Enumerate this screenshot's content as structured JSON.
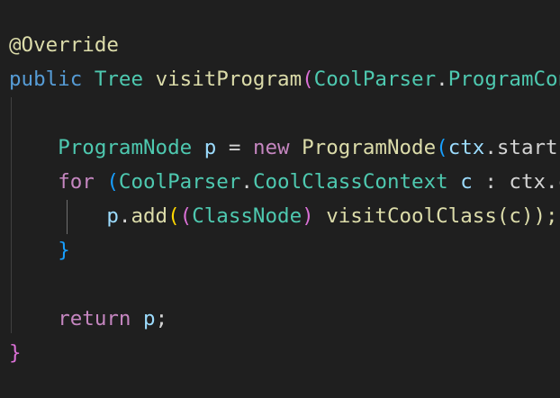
{
  "editor": {
    "language": "java",
    "theme": "dark-plus",
    "lines": [
      {
        "tokens": [
          {
            "text": "@Override",
            "kind": "annotation"
          }
        ]
      },
      {
        "tokens": [
          {
            "text": "public",
            "kind": "keyword"
          },
          {
            "text": " ",
            "kind": "plain"
          },
          {
            "text": "Tree",
            "kind": "type"
          },
          {
            "text": " ",
            "kind": "plain"
          },
          {
            "text": "visitProgram",
            "kind": "method"
          },
          {
            "text": "(",
            "kind": "paren1"
          },
          {
            "text": "CoolParser",
            "kind": "type"
          },
          {
            "text": ".",
            "kind": "plain"
          },
          {
            "text": "ProgramContext ctx",
            "kind": "type"
          }
        ]
      },
      {
        "tokens": []
      },
      {
        "tokens": [
          {
            "text": "    ",
            "kind": "plain"
          },
          {
            "text": "ProgramNode",
            "kind": "type"
          },
          {
            "text": " ",
            "kind": "plain"
          },
          {
            "text": "p",
            "kind": "var"
          },
          {
            "text": " = ",
            "kind": "op"
          },
          {
            "text": "new",
            "kind": "control"
          },
          {
            "text": " ",
            "kind": "plain"
          },
          {
            "text": "ProgramNode",
            "kind": "method"
          },
          {
            "text": "(",
            "kind": "paren2"
          },
          {
            "text": "ctx",
            "kind": "var"
          },
          {
            "text": ".start);",
            "kind": "plain"
          }
        ]
      },
      {
        "tokens": [
          {
            "text": "    ",
            "kind": "plain"
          },
          {
            "text": "for",
            "kind": "control"
          },
          {
            "text": " ",
            "kind": "plain"
          },
          {
            "text": "(",
            "kind": "paren2"
          },
          {
            "text": "CoolParser",
            "kind": "type"
          },
          {
            "text": ".",
            "kind": "plain"
          },
          {
            "text": "CoolClassContext",
            "kind": "type"
          },
          {
            "text": " ",
            "kind": "plain"
          },
          {
            "text": "c",
            "kind": "var"
          },
          {
            "text": " : ctx.coolClass()) {",
            "kind": "plain"
          }
        ]
      },
      {
        "tokens": [
          {
            "text": "        ",
            "kind": "plain"
          },
          {
            "text": "p",
            "kind": "var"
          },
          {
            "text": ".",
            "kind": "plain"
          },
          {
            "text": "add",
            "kind": "method"
          },
          {
            "text": "(",
            "kind": "paren3"
          },
          {
            "text": "(",
            "kind": "paren1"
          },
          {
            "text": "ClassNode",
            "kind": "type"
          },
          {
            "text": ")",
            "kind": "paren1"
          },
          {
            "text": " ",
            "kind": "plain"
          },
          {
            "text": "visitCoolClass(c));",
            "kind": "method"
          }
        ]
      },
      {
        "tokens": [
          {
            "text": "    ",
            "kind": "plain"
          },
          {
            "text": "}",
            "kind": "paren2"
          }
        ]
      },
      {
        "tokens": []
      },
      {
        "tokens": [
          {
            "text": "    ",
            "kind": "plain"
          },
          {
            "text": "return",
            "kind": "control"
          },
          {
            "text": " ",
            "kind": "plain"
          },
          {
            "text": "p",
            "kind": "var"
          },
          {
            "text": ";",
            "kind": "plain"
          }
        ]
      },
      {
        "tokens": [
          {
            "text": "}",
            "kind": "paren1"
          }
        ]
      }
    ]
  }
}
